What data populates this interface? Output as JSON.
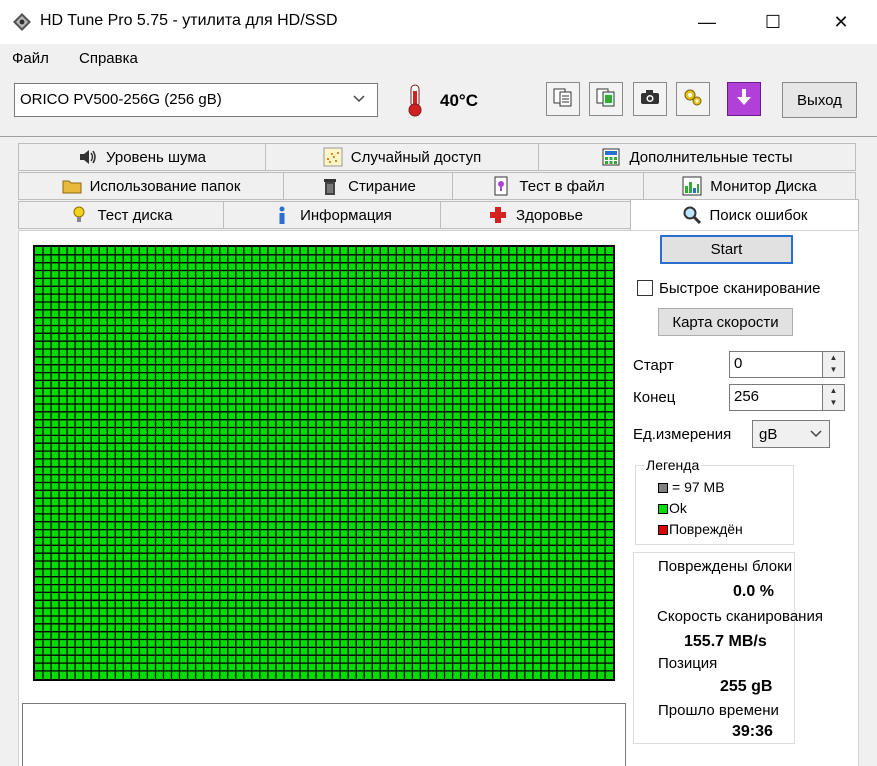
{
  "window": {
    "title": "HD Tune Pro 5.75 - утилита для HD/SSD",
    "minimize": "—",
    "maximize": "☐",
    "close": "✕"
  },
  "menu": {
    "file": "Файл",
    "help": "Справка"
  },
  "toolbar": {
    "drive": "ORICO PV500-256G (256 gB)",
    "temperature": "40°C",
    "exit_label": "Выход"
  },
  "tabs": {
    "row1": [
      "Уровень шума",
      "Случайный доступ",
      "Дополнительные  тесты"
    ],
    "row2": [
      "Использование папок",
      "Стирание",
      "Тест в файл",
      "Монитор Диска"
    ],
    "row3": [
      "Тест диска",
      "Информация",
      "Здоровье",
      "Поиск ошибок"
    ]
  },
  "controls": {
    "start_button": "Start",
    "quick_scan_label": "Быстрое сканирование",
    "quick_scan_checked": false,
    "speed_map_button": "Карта скорости",
    "start_label": "Старт",
    "start_value": "0",
    "end_label": "Конец",
    "end_value": "256",
    "unit_label": "Ед.измерения",
    "unit_value": "gB"
  },
  "legend": {
    "title": "Легенда",
    "block_size": "= 97 MB",
    "ok": "Ok",
    "damaged": "Повреждён",
    "colors": {
      "block": "#808080",
      "ok": "#00dd00",
      "damaged": "#dd0000"
    }
  },
  "stats": {
    "damaged_blocks_label": "Повреждены блоки",
    "damaged_blocks_value": "0.0 %",
    "scan_speed_label": "Скорость сканирования",
    "scan_speed_value": "155.7 MB/s",
    "position_label": "Позиция",
    "position_value": "255 gB",
    "elapsed_label": "Прошло времени",
    "elapsed_value": "39:36"
  },
  "scan_progress": 1.0,
  "colors": {
    "grid_ok": "#00dd00",
    "grid_line": "#000000"
  }
}
